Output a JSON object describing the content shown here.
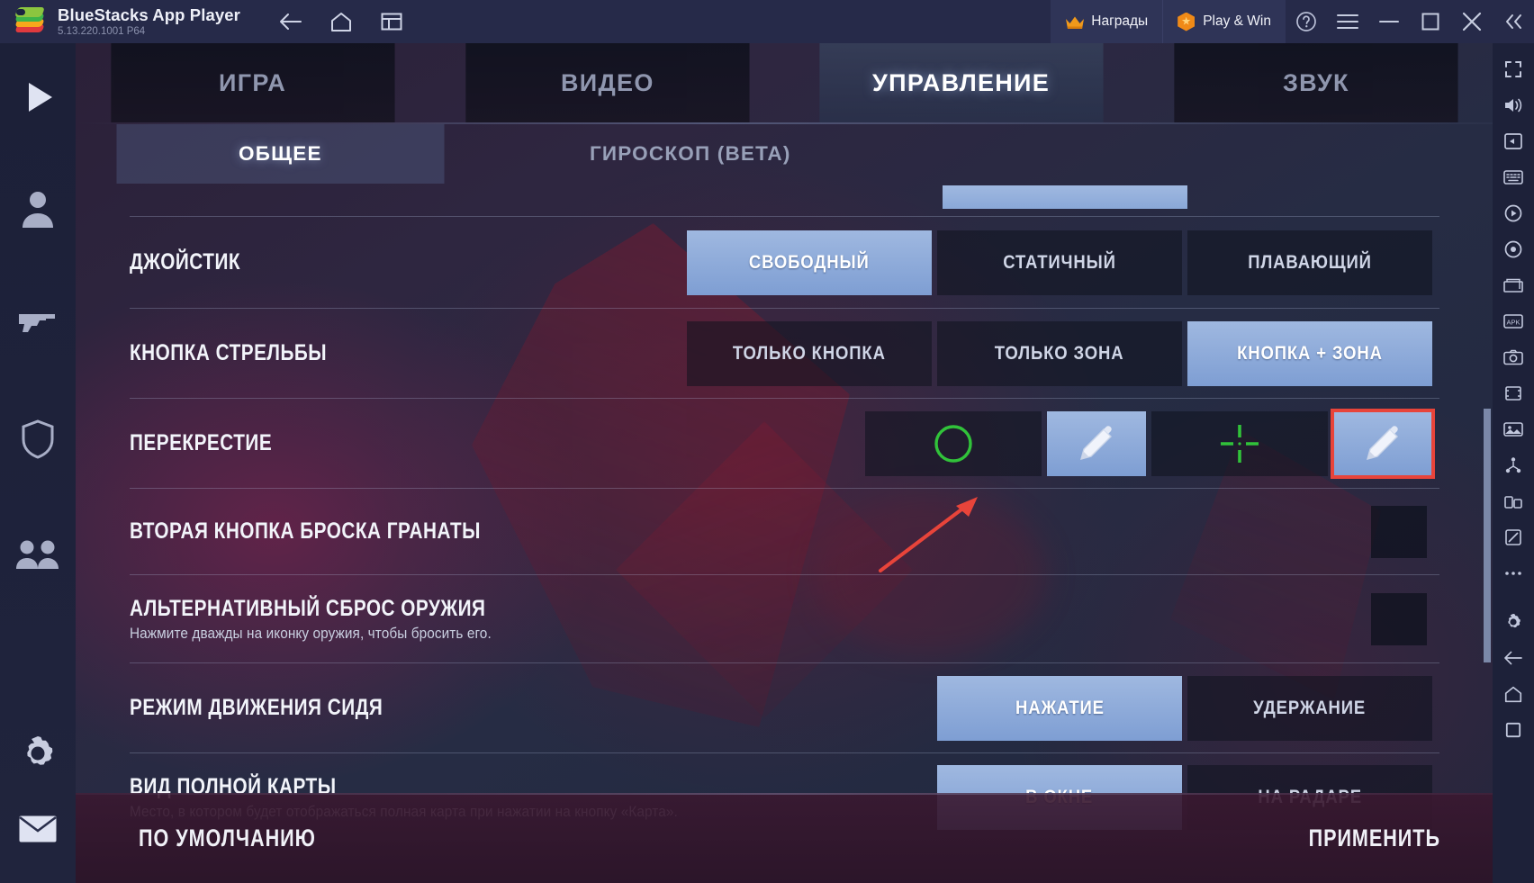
{
  "titlebar": {
    "app_name": "BlueStacks App Player",
    "version": "5.13.220.1001  P64",
    "back_icon": "back-arrow-icon",
    "home_icon": "home-icon",
    "multi_instance_icon": "multi-instance-icon",
    "rewards_label": "Награды",
    "play_win_label": "Play & Win",
    "help_icon": "help-icon",
    "menu_icon": "hamburger-menu-icon",
    "minimize_icon": "minimize-icon",
    "maximize_icon": "maximize-icon",
    "close_icon": "close-icon",
    "collapse_icon": "double-chevron-left-icon",
    "accent_orange": "#f08a17"
  },
  "left_sidebar": {
    "items": [
      {
        "icon": "play-icon",
        "name": "play"
      },
      {
        "icon": "person-icon",
        "name": "character"
      },
      {
        "icon": "gun-icon",
        "name": "weapon"
      },
      {
        "icon": "shield-icon",
        "name": "shield"
      },
      {
        "icon": "people-icon",
        "name": "squad"
      },
      {
        "icon": "gear-icon",
        "name": "settings"
      },
      {
        "icon": "mail-icon",
        "name": "mail"
      }
    ]
  },
  "right_sidebar": {
    "items": [
      {
        "icon": "fullscreen-icon",
        "name": "fullscreen"
      },
      {
        "icon": "volume-icon",
        "name": "volume"
      },
      {
        "icon": "keymap-overlay-icon",
        "name": "keymap-overlay"
      },
      {
        "icon": "keyboard-icon",
        "name": "keyboard-controls"
      },
      {
        "icon": "record-icon",
        "name": "screen-record"
      },
      {
        "icon": "macro-icon",
        "name": "macro-recorder"
      },
      {
        "icon": "multi-instance-icon",
        "name": "multi-instance"
      },
      {
        "icon": "apk-icon",
        "name": "install-apk"
      },
      {
        "icon": "screenshot-icon",
        "name": "screenshot"
      },
      {
        "icon": "crop-icon",
        "name": "crop-capture"
      },
      {
        "icon": "media-icon",
        "name": "media-manager"
      },
      {
        "icon": "sync-icon",
        "name": "sync-operations"
      },
      {
        "icon": "rotate-icon",
        "name": "rotate"
      },
      {
        "icon": "eco-mode-icon",
        "name": "eco-mode"
      },
      {
        "icon": "more-icon",
        "name": "more"
      },
      {
        "icon": "settings-gear-icon",
        "name": "settings"
      },
      {
        "icon": "back-icon",
        "name": "back"
      },
      {
        "icon": "home-icon",
        "name": "home"
      },
      {
        "icon": "recents-icon",
        "name": "recents"
      }
    ]
  },
  "tabs": [
    {
      "label": "ИГРА",
      "active": false
    },
    {
      "label": "ВИДЕО",
      "active": false
    },
    {
      "label": "УПРАВЛЕНИЕ",
      "active": true
    },
    {
      "label": "ЗВУК",
      "active": false
    }
  ],
  "subtabs": [
    {
      "label": "ОБЩЕЕ",
      "active": true
    },
    {
      "label": "ГИРОСКОП (BETA)",
      "active": false
    }
  ],
  "settings": [
    {
      "title": "ДЖОЙСТИК",
      "subtitle": "",
      "type": "options",
      "options": [
        {
          "label": "СВОБОДНЫЙ",
          "selected": true
        },
        {
          "label": "СТАТИЧНЫЙ",
          "selected": false
        },
        {
          "label": "ПЛАВАЮЩИЙ",
          "selected": false
        }
      ]
    },
    {
      "title": "КНОПКА СТРЕЛЬБЫ",
      "subtitle": "",
      "type": "options",
      "options": [
        {
          "label": "ТОЛЬКО КНОПКА",
          "selected": false
        },
        {
          "label": "ТОЛЬКО ЗОНА",
          "selected": false
        },
        {
          "label": "КНОПКА + ЗОНА",
          "selected": true
        }
      ]
    },
    {
      "title": "ПЕРЕКРЕСТИЕ",
      "subtitle": "",
      "type": "icon-options",
      "options": [
        {
          "icon": "green-circle-crosshair-icon",
          "selected": false,
          "highlighted": false
        },
        {
          "icon": "pencil-edit-icon",
          "selected": true,
          "highlighted": false
        },
        {
          "icon": "green-cross-crosshair-icon",
          "selected": false,
          "highlighted": false
        },
        {
          "icon": "pencil-edit-icon",
          "selected": true,
          "highlighted": true
        }
      ]
    },
    {
      "title": "ВТОРАЯ КНОПКА БРОСКА ГРАНАТЫ",
      "subtitle": "",
      "type": "toggle",
      "value": "off"
    },
    {
      "title": "АЛЬТЕРНАТИВНЫЙ СБРОС ОРУЖИЯ",
      "subtitle": "Нажмите дважды на иконку оружия, чтобы бросить его.",
      "type": "toggle",
      "value": "off"
    },
    {
      "title": "РЕЖИМ ДВИЖЕНИЯ СИДЯ",
      "subtitle": "",
      "type": "options",
      "options": [
        {
          "label": "НАЖАТИЕ",
          "selected": true
        },
        {
          "label": "УДЕРЖАНИЕ",
          "selected": false
        }
      ]
    },
    {
      "title": "ВИД ПОЛНОЙ КАРТЫ",
      "subtitle": "Место, в котором будет отображаться полная карта при нажатии на кнопку «Карта».",
      "type": "options",
      "options": [
        {
          "label": "В ОКНЕ",
          "selected": true
        },
        {
          "label": "НА РАДАРЕ",
          "selected": false
        }
      ]
    }
  ],
  "footer": {
    "default_label": "ПО УМОЛЧАНИЮ",
    "apply_label": "ПРИМЕНИТЬ"
  },
  "annotation": {
    "arrow_color": "#e8443a",
    "highlight_color": "#e8443a"
  }
}
